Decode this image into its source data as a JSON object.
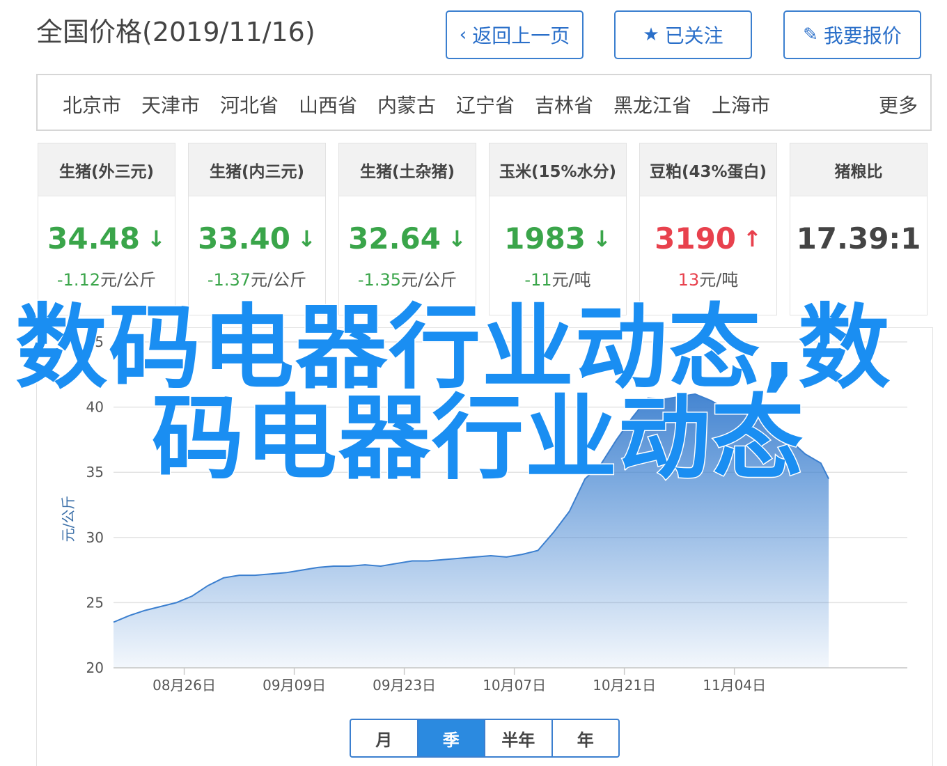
{
  "header": {
    "title": "全国价格(2019/11/16)",
    "back_label": "返回上一页",
    "follow_label": "已关注",
    "quote_label": "我要报价"
  },
  "regions": {
    "items": [
      "北京市",
      "天津市",
      "河北省",
      "山西省",
      "内蒙古",
      "辽宁省",
      "吉林省",
      "黑龙江省",
      "上海市"
    ],
    "more_label": "更多"
  },
  "cards": [
    {
      "name": "生猪(外三元)",
      "value": "34.48",
      "trend": "down",
      "change_num": "-1.12",
      "change_unit": "元/公斤"
    },
    {
      "name": "生猪(内三元)",
      "value": "33.40",
      "trend": "down",
      "change_num": "-1.37",
      "change_unit": "元/公斤"
    },
    {
      "name": "生猪(土杂猪)",
      "value": "32.64",
      "trend": "down",
      "change_num": "-1.35",
      "change_unit": "元/公斤"
    },
    {
      "name": "玉米(15%水分)",
      "value": "1983",
      "trend": "down",
      "change_num": "-11",
      "change_unit": "元/吨"
    },
    {
      "name": "豆粕(43%蛋白)",
      "value": "3190",
      "trend": "up",
      "change_num": "13",
      "change_unit": "元/吨"
    },
    {
      "name": "猪粮比",
      "value": "17.39:1",
      "trend": "none",
      "change_num": "",
      "change_unit": ""
    }
  ],
  "colors": {
    "accent": "#2b8ae0",
    "down": "#3aa54a",
    "up": "#e8414d",
    "series": "#3b7fcf"
  },
  "range_tabs": [
    {
      "label": "月",
      "active": false
    },
    {
      "label": "季",
      "active": true
    },
    {
      "label": "半年",
      "active": false
    },
    {
      "label": "年",
      "active": false
    }
  ],
  "watermark": {
    "line1": "数码电器行业动态,数",
    "line2": "码电器行业动态"
  },
  "chart_data": {
    "type": "area",
    "ylabel": "元/公斤",
    "ylim": [
      20,
      45
    ],
    "yticks": [
      20,
      25,
      30,
      35,
      40,
      45
    ],
    "xticks": [
      {
        "label": "08月26日",
        "date": "2019-08-26"
      },
      {
        "label": "09月09日",
        "date": "2019-09-09"
      },
      {
        "label": "09月23日",
        "date": "2019-09-23"
      },
      {
        "label": "10月07日",
        "date": "2019-10-07"
      },
      {
        "label": "10月21日",
        "date": "2019-10-21"
      },
      {
        "label": "11月04日",
        "date": "2019-11-04"
      }
    ],
    "x_range": [
      "2019-08-17",
      "2019-11-26"
    ],
    "grid": true,
    "series": [
      {
        "x": [
          "2019-08-17",
          "2019-08-19",
          "2019-08-21",
          "2019-08-23",
          "2019-08-25",
          "2019-08-27",
          "2019-08-29",
          "2019-08-31",
          "2019-09-02",
          "2019-09-04",
          "2019-09-06",
          "2019-09-08",
          "2019-09-10",
          "2019-09-12",
          "2019-09-14",
          "2019-09-16",
          "2019-09-18",
          "2019-09-20",
          "2019-09-22",
          "2019-09-24",
          "2019-09-26",
          "2019-09-28",
          "2019-09-30",
          "2019-10-02",
          "2019-10-04",
          "2019-10-06",
          "2019-10-08",
          "2019-10-10",
          "2019-10-12",
          "2019-10-14",
          "2019-10-16",
          "2019-10-18",
          "2019-10-20",
          "2019-10-22",
          "2019-10-24",
          "2019-10-26",
          "2019-10-28",
          "2019-10-30",
          "2019-11-01",
          "2019-11-03",
          "2019-11-05",
          "2019-11-07",
          "2019-11-09",
          "2019-11-11",
          "2019-11-13",
          "2019-11-15",
          "2019-11-16"
        ],
        "values": [
          23.5,
          24.0,
          24.4,
          24.7,
          25.0,
          25.5,
          26.3,
          26.9,
          27.1,
          27.1,
          27.2,
          27.3,
          27.5,
          27.7,
          27.8,
          27.8,
          27.9,
          27.8,
          28.0,
          28.2,
          28.2,
          28.3,
          28.4,
          28.5,
          28.6,
          28.5,
          28.7,
          29.0,
          30.4,
          32.0,
          34.5,
          35.6,
          37.5,
          39.2,
          40.7,
          40.6,
          40.8,
          41.0,
          40.5,
          39.8,
          39.9,
          39.6,
          38.8,
          37.5,
          36.4,
          35.7,
          34.5
        ]
      }
    ]
  }
}
